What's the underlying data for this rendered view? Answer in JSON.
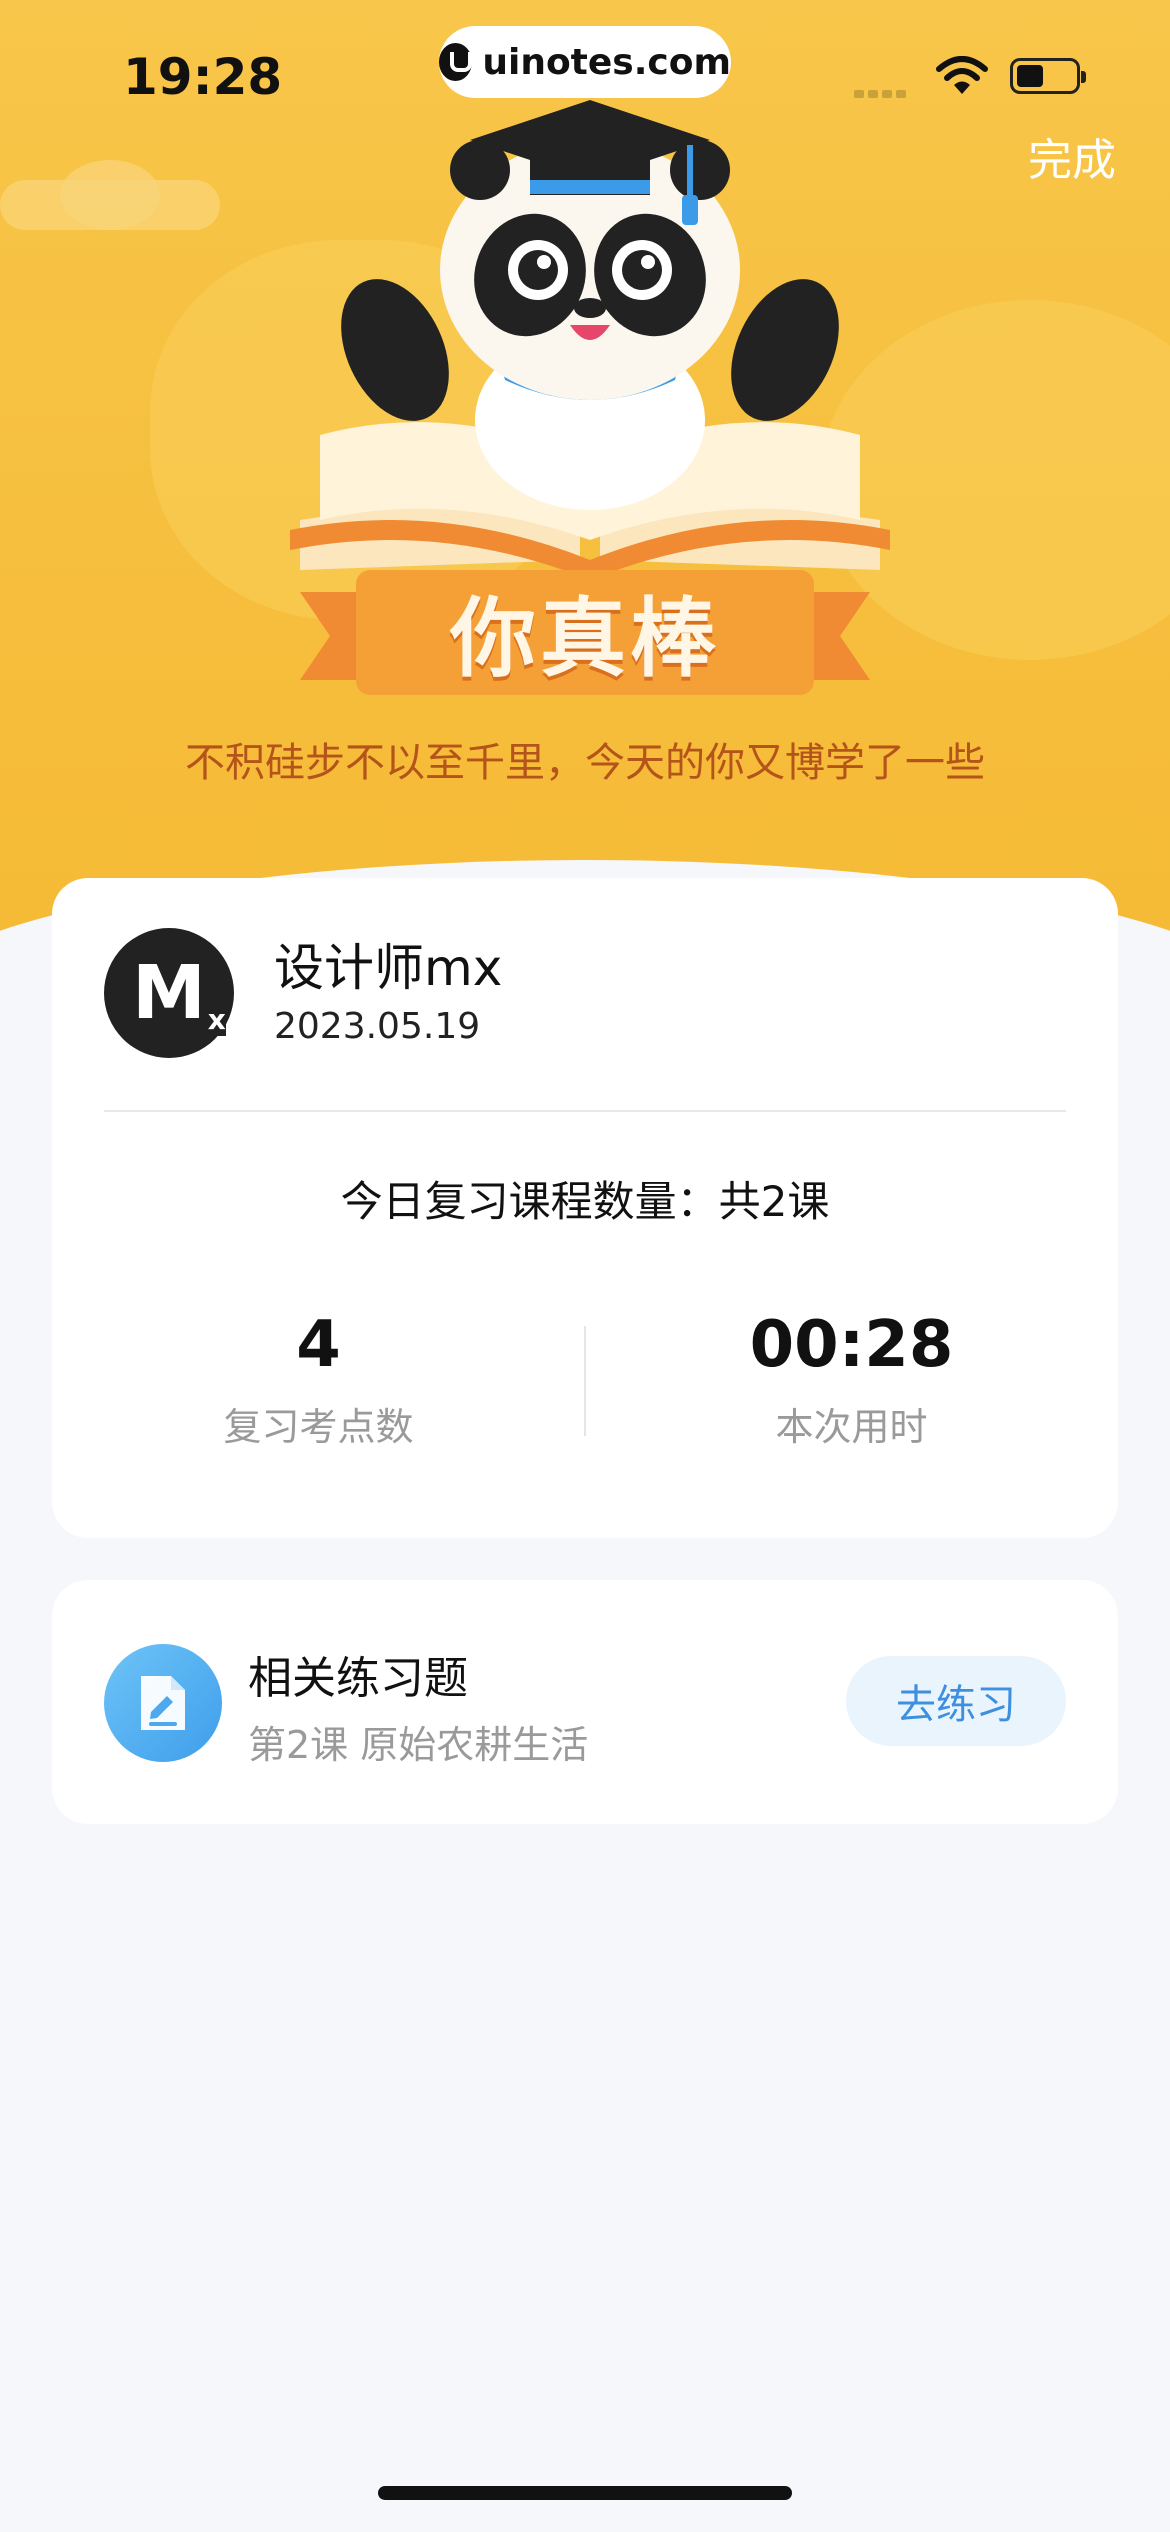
{
  "status_bar": {
    "time": "19:28",
    "url": "uinotes.com"
  },
  "header": {
    "done_label": "完成"
  },
  "banner": {
    "title": "你真棒",
    "subtitle": "不积硅步不以至千里，今天的你又博学了一些"
  },
  "user": {
    "name": "设计师mx",
    "date": "2023.05.19",
    "avatar_text": "M",
    "avatar_sub": "x"
  },
  "summary": {
    "count_text": "今日复习课程数量：共2课",
    "stats": [
      {
        "value": "4",
        "label": "复习考点数"
      },
      {
        "value": "00:28",
        "label": "本次用时"
      }
    ]
  },
  "exercise": {
    "title": "相关练习题",
    "subtitle": "第2课 原始农耕生活",
    "button_label": "去练习"
  },
  "colors": {
    "hero_yellow": "#F6BE3C",
    "accent_blue": "#3D8FE0",
    "subtitle_brown": "#B4541A"
  },
  "icons": [
    "wifi-icon",
    "battery-icon",
    "panda-mascot",
    "document-icon"
  ]
}
